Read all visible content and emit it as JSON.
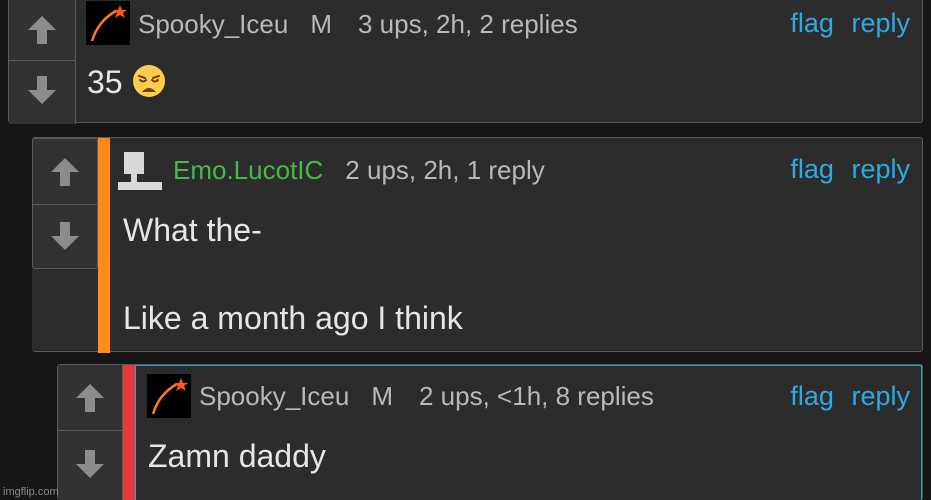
{
  "colors": {
    "background": "#161616",
    "card": "#2c2c2c",
    "border": "#5a5a5a",
    "link": "#2fa9e0",
    "username_green": "#48b84a",
    "thread_orange": "#ff8c1a",
    "thread_red": "#e8393d"
  },
  "comments": [
    {
      "username": "Spooky_Iceu",
      "badge": "M",
      "stats": "3 ups, 2h, 2 replies",
      "body": "35",
      "emoji": "weary-face",
      "flag": "flag",
      "reply": "reply"
    },
    {
      "username": "Emo.LucotIC",
      "badge": "",
      "stats": "2 ups, 2h, 1 reply",
      "body": "What the-\n\nLike a month ago I think",
      "flag": "flag",
      "reply": "reply"
    },
    {
      "username": "Spooky_Iceu",
      "badge": "M",
      "stats": "2 ups, <1h, 8 replies",
      "body": "Zamn daddy",
      "flag": "flag",
      "reply": "reply"
    }
  ],
  "watermark": "imgflip.com"
}
